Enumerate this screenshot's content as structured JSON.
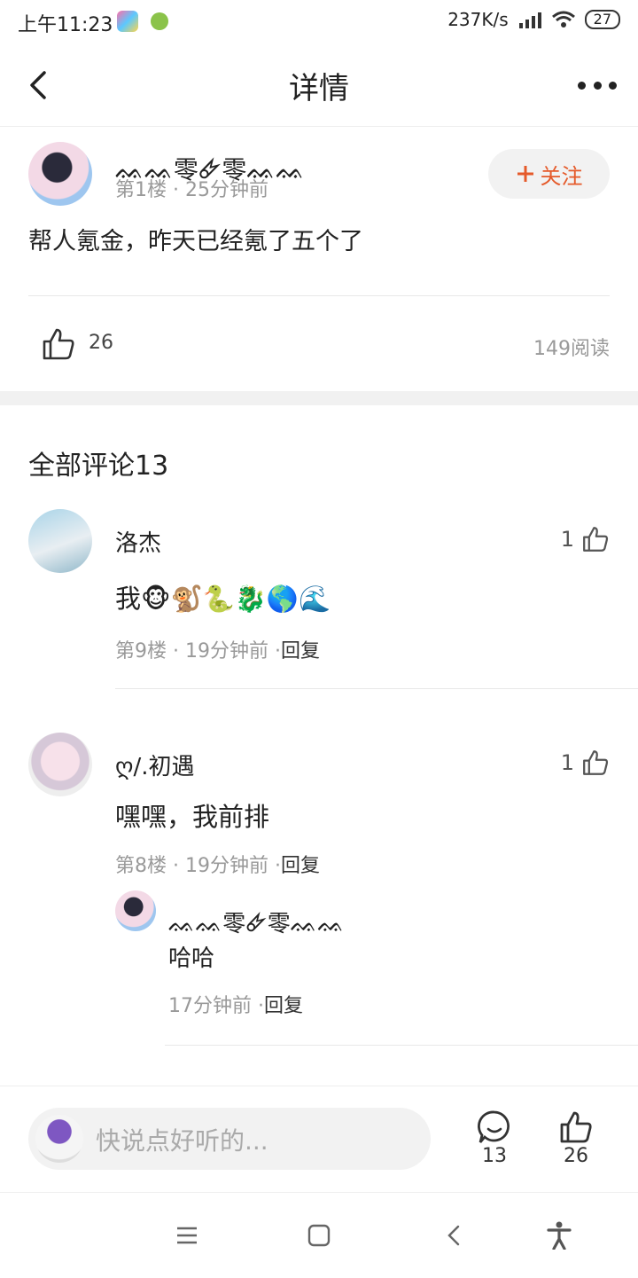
{
  "status_bar": {
    "time": "上午11:23",
    "net_speed": "237K/s",
    "battery": "27"
  },
  "header": {
    "title": "详情"
  },
  "post": {
    "author": "ᨐᨐ零🜸零ᨐᨐ",
    "floor_time": "第1楼 · 25分钟前",
    "follow_label": "关注",
    "content": "帮人氪金，昨天已经氪了五个了",
    "likes": "26",
    "reads": "149阅读"
  },
  "comments_title": "全部评论13",
  "comments": [
    {
      "name": "洛杰",
      "text": "我🐵🐒🐍🐉🌎🌊",
      "meta": "第9楼 · 19分钟前 ·",
      "reply": "回复",
      "likes": "1"
    },
    {
      "name": "ღ/.初遇",
      "text": "嘿嘿，我前排",
      "meta": "第8楼 · 19分钟前 ·",
      "reply": "回复",
      "likes": "1"
    }
  ],
  "sub_reply": {
    "name": "ᨐᨐ零🜸零ᨐᨐ",
    "text": "哈哈",
    "meta": "17分钟前 ·",
    "reply": "回复"
  },
  "bottom_bar": {
    "placeholder": "快说点好听的...",
    "comment_count": "13",
    "like_count": "26"
  },
  "colors": {
    "accent": "#e55a2a",
    "muted": "#999999"
  }
}
